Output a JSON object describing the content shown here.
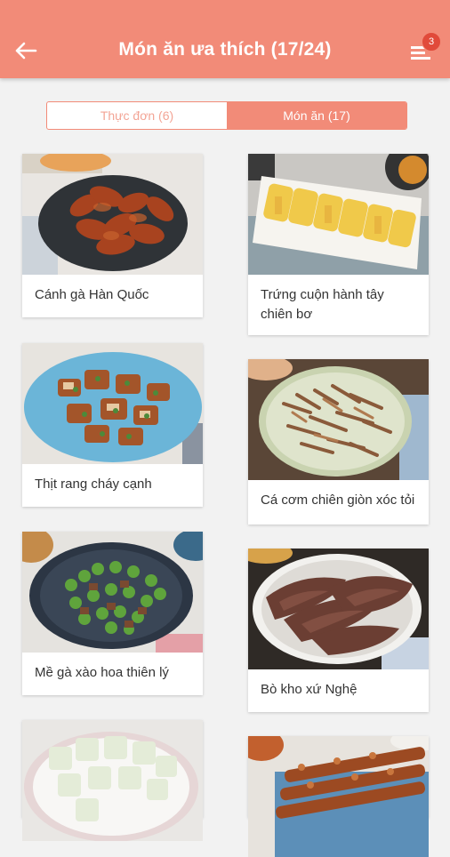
{
  "header": {
    "title": "Món ăn ưa thích (17/24)",
    "badge_count": "3"
  },
  "tabs": [
    {
      "label": "Thực đơn (6)",
      "active": false
    },
    {
      "label": "Món ăn (17)",
      "active": true
    }
  ],
  "dishes": [
    {
      "name": "Cánh gà Hàn Quốc"
    },
    {
      "name": "Trứng cuộn hành tây chiên bơ"
    },
    {
      "name": "Thịt rang cháy cạnh"
    },
    {
      "name": "Cá cơm chiên giòn xóc tỏi"
    },
    {
      "name": "Mề gà xào hoa thiên lý"
    },
    {
      "name": "Bò kho xứ Nghệ"
    }
  ],
  "colors": {
    "primary": "#f28b78",
    "badge": "#e14a3a"
  }
}
